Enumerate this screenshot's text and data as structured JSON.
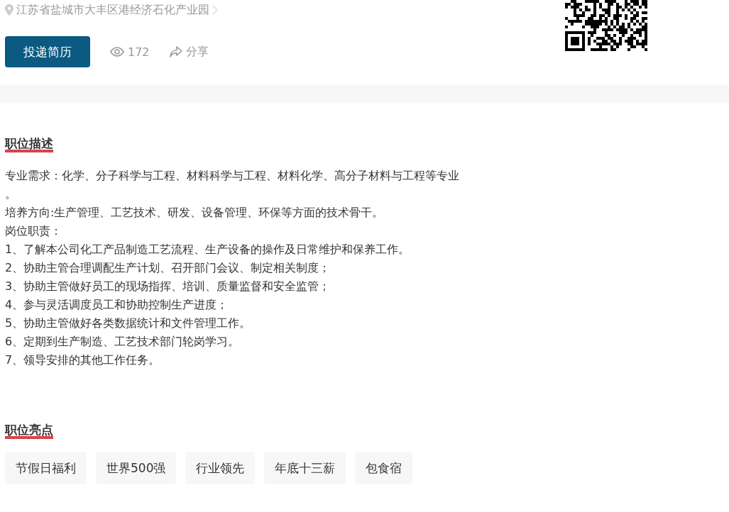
{
  "job_header": {
    "address": "江苏省盐城市大丰区港经济石化产业园",
    "apply_button": "投递简历",
    "views": "172",
    "share": "分享"
  },
  "description": {
    "title": "职位描述",
    "lines": [
      "专业需求：化学、分子科学与工程、材料科学与工程、材料化学、高分子材料与工程等专业",
      "。",
      "培养方向:生产管理、工艺技术、研发、设备管理、环保等方面的技术骨干。",
      "岗位职责：",
      "1、了解本公司化工产品制造工艺流程、生产设备的操作及日常维护和保养工作。",
      "2、协助主管合理调配生产计划、召开部门会议、制定相关制度；",
      "3、协助主管做好员工的现场指挥、培训、质量监督和安全监管；",
      "4、参与灵活调度员工和协助控制生产进度；",
      "5、协助主管做好各类数据统计和文件管理工作。",
      "6、定期到生产制造、工艺技术部门轮岗学习。",
      "7、领导安排的其他工作任务。"
    ]
  },
  "highlights": {
    "title": "职位亮点",
    "tags": [
      "节假日福利",
      "世界500强",
      "行业领先",
      "年底十三薪",
      "包食宿"
    ]
  }
}
